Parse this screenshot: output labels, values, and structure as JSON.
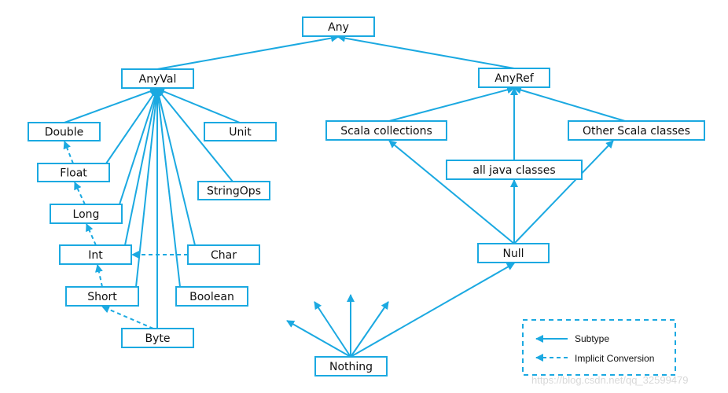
{
  "diagram": {
    "nodes": {
      "any": "Any",
      "anyval": "AnyVal",
      "anyref": "AnyRef",
      "double": "Double",
      "unit": "Unit",
      "float": "Float",
      "long": "Long",
      "stringops": "StringOps",
      "int": "Int",
      "char": "Char",
      "short": "Short",
      "boolean": "Boolean",
      "byte": "Byte",
      "scala_collections": "Scala collections",
      "java_classes": "all java classes",
      "other_scala": "Other Scala classes",
      "null": "Null",
      "nothing": "Nothing"
    },
    "subtype_edges": [
      [
        "anyval",
        "any"
      ],
      [
        "anyref",
        "any"
      ],
      [
        "double",
        "anyval"
      ],
      [
        "float",
        "anyval"
      ],
      [
        "long",
        "anyval"
      ],
      [
        "int",
        "anyval"
      ],
      [
        "short",
        "anyval"
      ],
      [
        "byte",
        "anyval"
      ],
      [
        "boolean",
        "anyval"
      ],
      [
        "char",
        "anyval"
      ],
      [
        "stringops",
        "anyval"
      ],
      [
        "unit",
        "anyval"
      ],
      [
        "scala_collections",
        "anyref"
      ],
      [
        "java_classes",
        "anyref"
      ],
      [
        "other_scala",
        "anyref"
      ],
      [
        "null",
        "scala_collections"
      ],
      [
        "null",
        "java_classes"
      ],
      [
        "null",
        "other_scala"
      ],
      [
        "nothing",
        "null"
      ]
    ],
    "conversion_edges": [
      [
        "float",
        "double"
      ],
      [
        "long",
        "float"
      ],
      [
        "int",
        "long"
      ],
      [
        "short",
        "int"
      ],
      [
        "byte",
        "short"
      ],
      [
        "char",
        "int"
      ]
    ],
    "color": "#1ba9e1",
    "legend": {
      "subtype": "Subtype",
      "implicit_conversion": "Implicit Conversion"
    },
    "watermark": "https://blog.csdn.net/qq_32599479"
  }
}
